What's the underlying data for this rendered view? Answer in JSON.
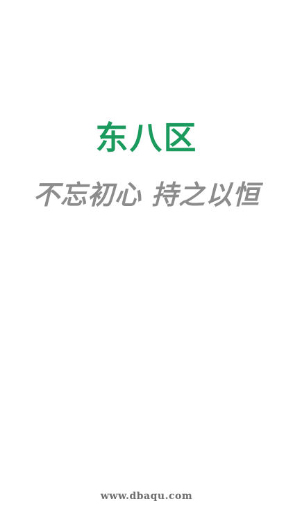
{
  "splash": {
    "logo_text": "东八区",
    "slogan": "不忘初心 持之以恒",
    "url": "www.dbaqu.com"
  },
  "colors": {
    "background": "#ffffff",
    "logo": "#1a9a5c",
    "slogan": "#8c8c8c",
    "url": "#6e6e6e"
  }
}
